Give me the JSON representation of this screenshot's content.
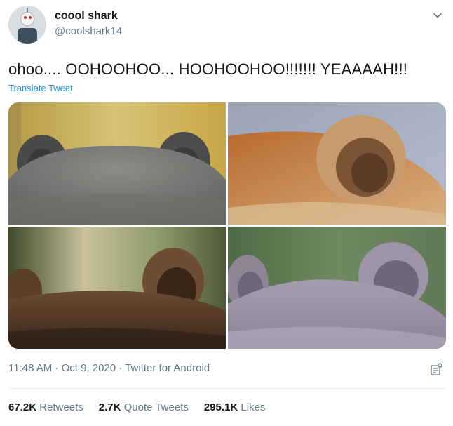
{
  "author": {
    "name": "coool shark",
    "handle": "@coolshark14"
  },
  "tweet": {
    "text": "ohoo.... OOHOOHOO... HOOHOOHOO!!!!!!! YEAAAAH!!!",
    "translate_label": "Translate Tweet"
  },
  "media": {
    "images": [
      "bear-ears-gray",
      "bear-ears-orange",
      "bear-ears-dark-brown",
      "bear-ears-lavender"
    ]
  },
  "meta": {
    "time": "11:48 AM",
    "date": "Oct 9, 2020",
    "source": "Twitter for Android",
    "full": "11:48 AM · Oct 9, 2020 · Twitter for Android"
  },
  "stats": {
    "retweets_count": "67.2K",
    "retweets_label": "Retweets",
    "quotes_count": "2.7K",
    "quotes_label": "Quote Tweets",
    "likes_count": "295.1K",
    "likes_label": "Likes"
  },
  "icons": {
    "menu": "chevron-down-icon",
    "analytics": "analytics-icon"
  },
  "colors": {
    "link": "#1b95e0",
    "secondary_text": "#657786",
    "primary_text": "#14171a"
  }
}
